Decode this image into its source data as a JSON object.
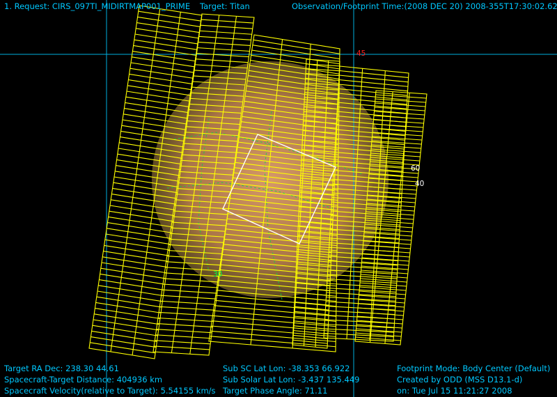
{
  "header": {
    "request": "1. Request: CIRS_097TI_MIDIRTMAP001_PRIME",
    "target": "Target: Titan",
    "time": "Observation/Footprint Time:(2008 DEC 20) 2008-355T17:30:02.62"
  },
  "grid_labels": {
    "lat_45": "45",
    "lon_60": "60",
    "lon_30": "30",
    "lon_40": "40"
  },
  "info_left": {
    "radec": "Target RA Dec: 238.30   44.61",
    "distance": "Spacecraft-Target Distance:  404936 km",
    "velocity": "Spacecraft Velocity(relative to Target): 5.54155 km/s"
  },
  "info_mid": {
    "subsc": "Sub SC Lat Lon: -38.353   66.922",
    "subsolar": "Sub Solar Lat Lon: -3.437   135.449",
    "phase": "Target Phase Angle: 71.11"
  },
  "info_right": {
    "mode": "Footprint Mode: Body Center (Default)",
    "created": "Created by ODD (MSS D13.1-d)",
    "on": "on: Tue Jul 15 11:21:27 2008"
  },
  "colors": {
    "background": "#000000",
    "text_cyan": "#00c8ff",
    "footprint": "#ffff00",
    "grid": "#00c8ff",
    "body": "#d89060",
    "label_red": "#ff2020",
    "label_green": "#00ff40",
    "fov_box": "#ffffff"
  }
}
